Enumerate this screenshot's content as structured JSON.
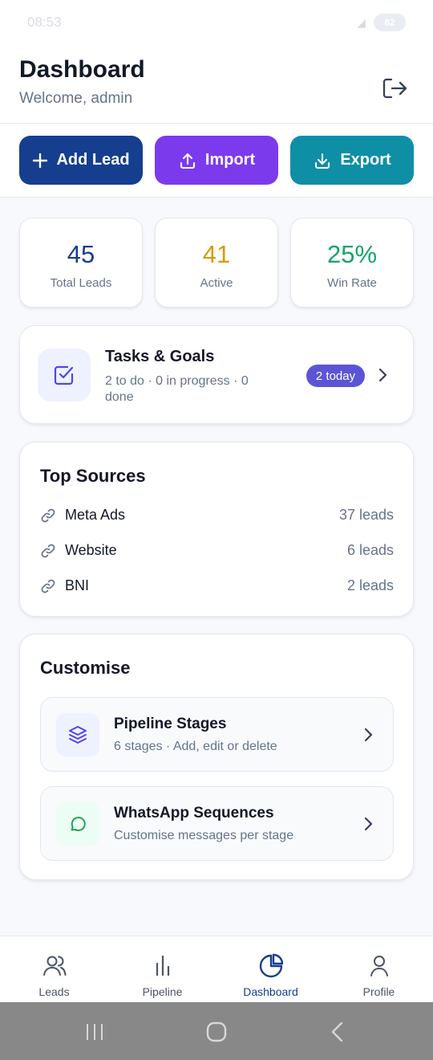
{
  "status_bar": {
    "time": "08:53",
    "battery": "82"
  },
  "header": {
    "title": "Dashboard",
    "subtitle": "Welcome, admin"
  },
  "actions": [
    {
      "label": "Add Lead",
      "icon": "plus-icon"
    },
    {
      "label": "Import",
      "icon": "upload-icon"
    },
    {
      "label": "Export",
      "icon": "download-icon"
    }
  ],
  "stats": [
    {
      "value": "45",
      "label": "Total Leads",
      "color": "#153e8f"
    },
    {
      "value": "41",
      "label": "Active",
      "color": "#d99a06"
    },
    {
      "value": "25%",
      "label": "Win Rate",
      "color": "#16a36a"
    }
  ],
  "tasks": {
    "title": "Tasks & Goals",
    "subtitle": "2 to do · 0 in progress · 0 done",
    "badge": "2 today"
  },
  "top_sources": {
    "title": "Top Sources",
    "items": [
      {
        "name": "Meta Ads",
        "count": "37 leads"
      },
      {
        "name": "Website",
        "count": "6 leads"
      },
      {
        "name": "BNI",
        "count": "2 leads"
      }
    ]
  },
  "customise": {
    "title": "Customise",
    "items": [
      {
        "title": "Pipeline Stages",
        "subtitle": "6 stages · Add, edit or delete",
        "icon": "layers-icon"
      },
      {
        "title": "WhatsApp Sequences",
        "subtitle": "Customise messages per stage",
        "icon": "chat-icon"
      }
    ]
  },
  "bottom_nav": {
    "active": "Dashboard",
    "items": [
      {
        "label": "Leads",
        "icon": "users-icon"
      },
      {
        "label": "Pipeline",
        "icon": "bar-chart-icon"
      },
      {
        "label": "Dashboard",
        "icon": "pie-chart-icon"
      },
      {
        "label": "Profile",
        "icon": "user-icon"
      }
    ]
  },
  "colors": {
    "primary": "#153e8f",
    "import": "#7c3aed",
    "export": "#0e8fa6",
    "badge": "#5b55d6"
  }
}
